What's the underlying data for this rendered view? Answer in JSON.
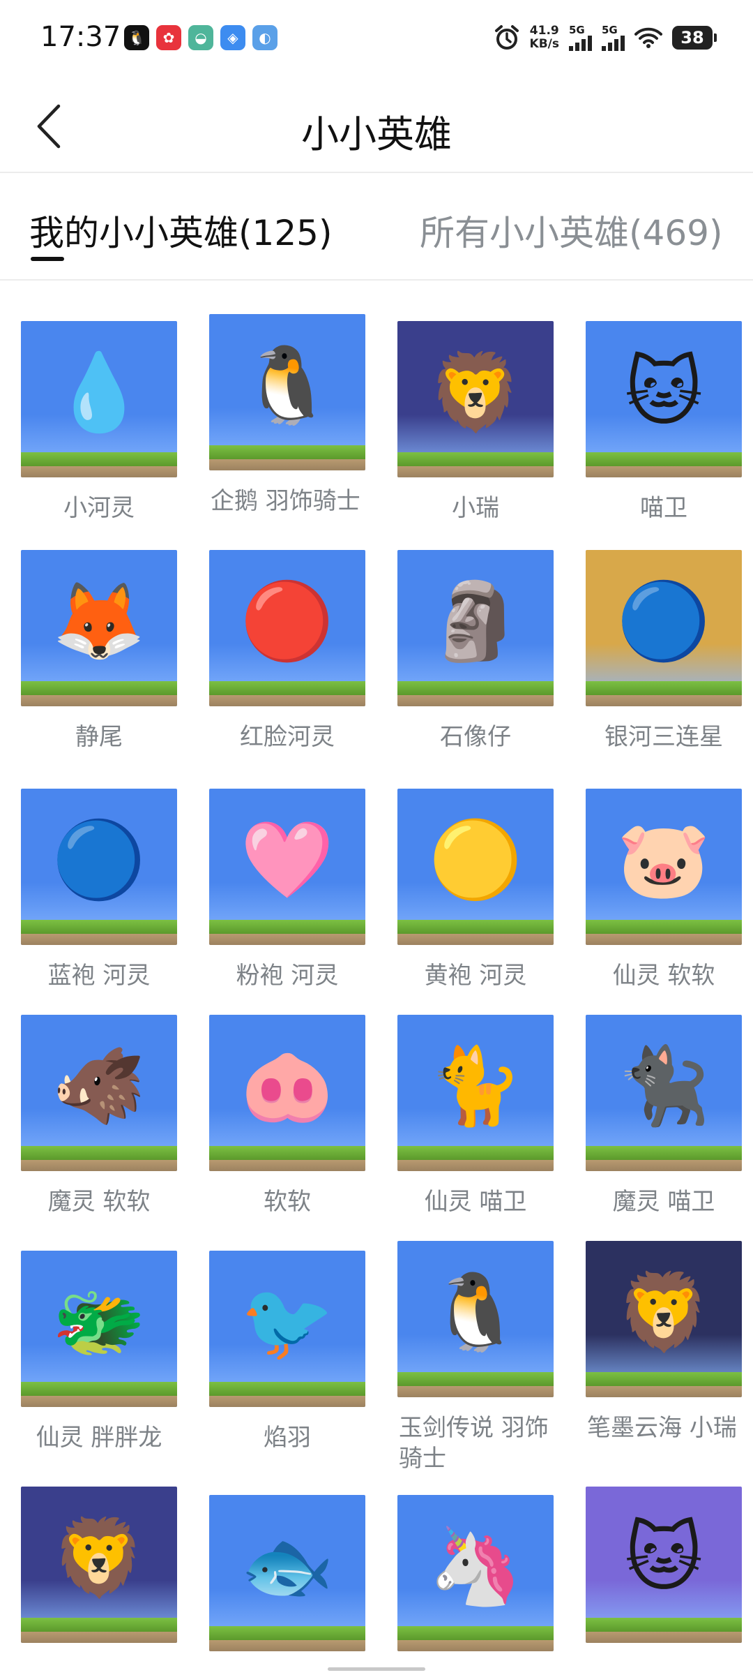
{
  "status_bar": {
    "time": "17:37",
    "speed_value": "41.9",
    "speed_unit": "KB/s",
    "net1": "5G",
    "net2": "5G",
    "battery": "38",
    "notifications": [
      {
        "icon": "qq-icon",
        "color": "#111111",
        "glyph": "🐧"
      },
      {
        "icon": "app-red-icon",
        "color": "#e8333c",
        "glyph": "✿"
      },
      {
        "icon": "app-green-icon",
        "color": "#4fb59a",
        "glyph": "◒"
      },
      {
        "icon": "app-blue-icon",
        "color": "#3d8cf0",
        "glyph": "◈"
      },
      {
        "icon": "app-doc-icon",
        "color": "#5aa0e8",
        "glyph": "◐"
      }
    ]
  },
  "header": {
    "title": "小小英雄"
  },
  "tabs": [
    {
      "label": "我的小小英雄(125)",
      "active": true
    },
    {
      "label": "所有小小英雄(469)",
      "active": false
    }
  ],
  "heroes": [
    {
      "name": "小河灵",
      "bg": "#4a86ee",
      "glyph": "💧"
    },
    {
      "name": "企鹅 羽饰骑士",
      "bg": "#4a86ee",
      "glyph": "🐧"
    },
    {
      "name": "小瑞",
      "bg": "#3a3f8c",
      "glyph": "🦁"
    },
    {
      "name": "喵卫",
      "bg": "#4a86ee",
      "glyph": "🐱"
    },
    {
      "name": "静尾",
      "bg": "#4a86ee",
      "glyph": "🦊"
    },
    {
      "name": "红脸河灵",
      "bg": "#4a86ee",
      "glyph": "🔴"
    },
    {
      "name": "石像仔",
      "bg": "#4a86ee",
      "glyph": "🗿"
    },
    {
      "name": "银河三连星",
      "bg": "#d8a84a",
      "glyph": "🔵"
    },
    {
      "name": "蓝袍 河灵",
      "bg": "#4a86ee",
      "glyph": "🔵"
    },
    {
      "name": "粉袍 河灵",
      "bg": "#4a86ee",
      "glyph": "🩷"
    },
    {
      "name": "黄袍 河灵",
      "bg": "#4a86ee",
      "glyph": "🟡"
    },
    {
      "name": "仙灵 软软",
      "bg": "#4a86ee",
      "glyph": "🐷"
    },
    {
      "name": "魔灵 软软",
      "bg": "#4a86ee",
      "glyph": "🐗"
    },
    {
      "name": "软软",
      "bg": "#4a86ee",
      "glyph": "🐽"
    },
    {
      "name": "仙灵 喵卫",
      "bg": "#4a86ee",
      "glyph": "🐈"
    },
    {
      "name": "魔灵 喵卫",
      "bg": "#4a86ee",
      "glyph": "🐈‍⬛"
    },
    {
      "name": "仙灵 胖胖龙",
      "bg": "#4a86ee",
      "glyph": "🐲"
    },
    {
      "name": "焰羽",
      "bg": "#4a86ee",
      "glyph": "🐦"
    },
    {
      "name": "玉剑传说 羽饰骑士",
      "bg": "#4a86ee",
      "glyph": "🐧"
    },
    {
      "name": "笔墨云海 小瑞",
      "bg": "#2c3160",
      "glyph": "🦁"
    },
    {
      "name": "",
      "bg": "#3a3f8c",
      "glyph": "🦁"
    },
    {
      "name": "",
      "bg": "#4a86ee",
      "glyph": "🐟"
    },
    {
      "name": "",
      "bg": "#4a86ee",
      "glyph": "🦄"
    },
    {
      "name": "",
      "bg": "#7a68d8",
      "glyph": "🐱"
    }
  ]
}
